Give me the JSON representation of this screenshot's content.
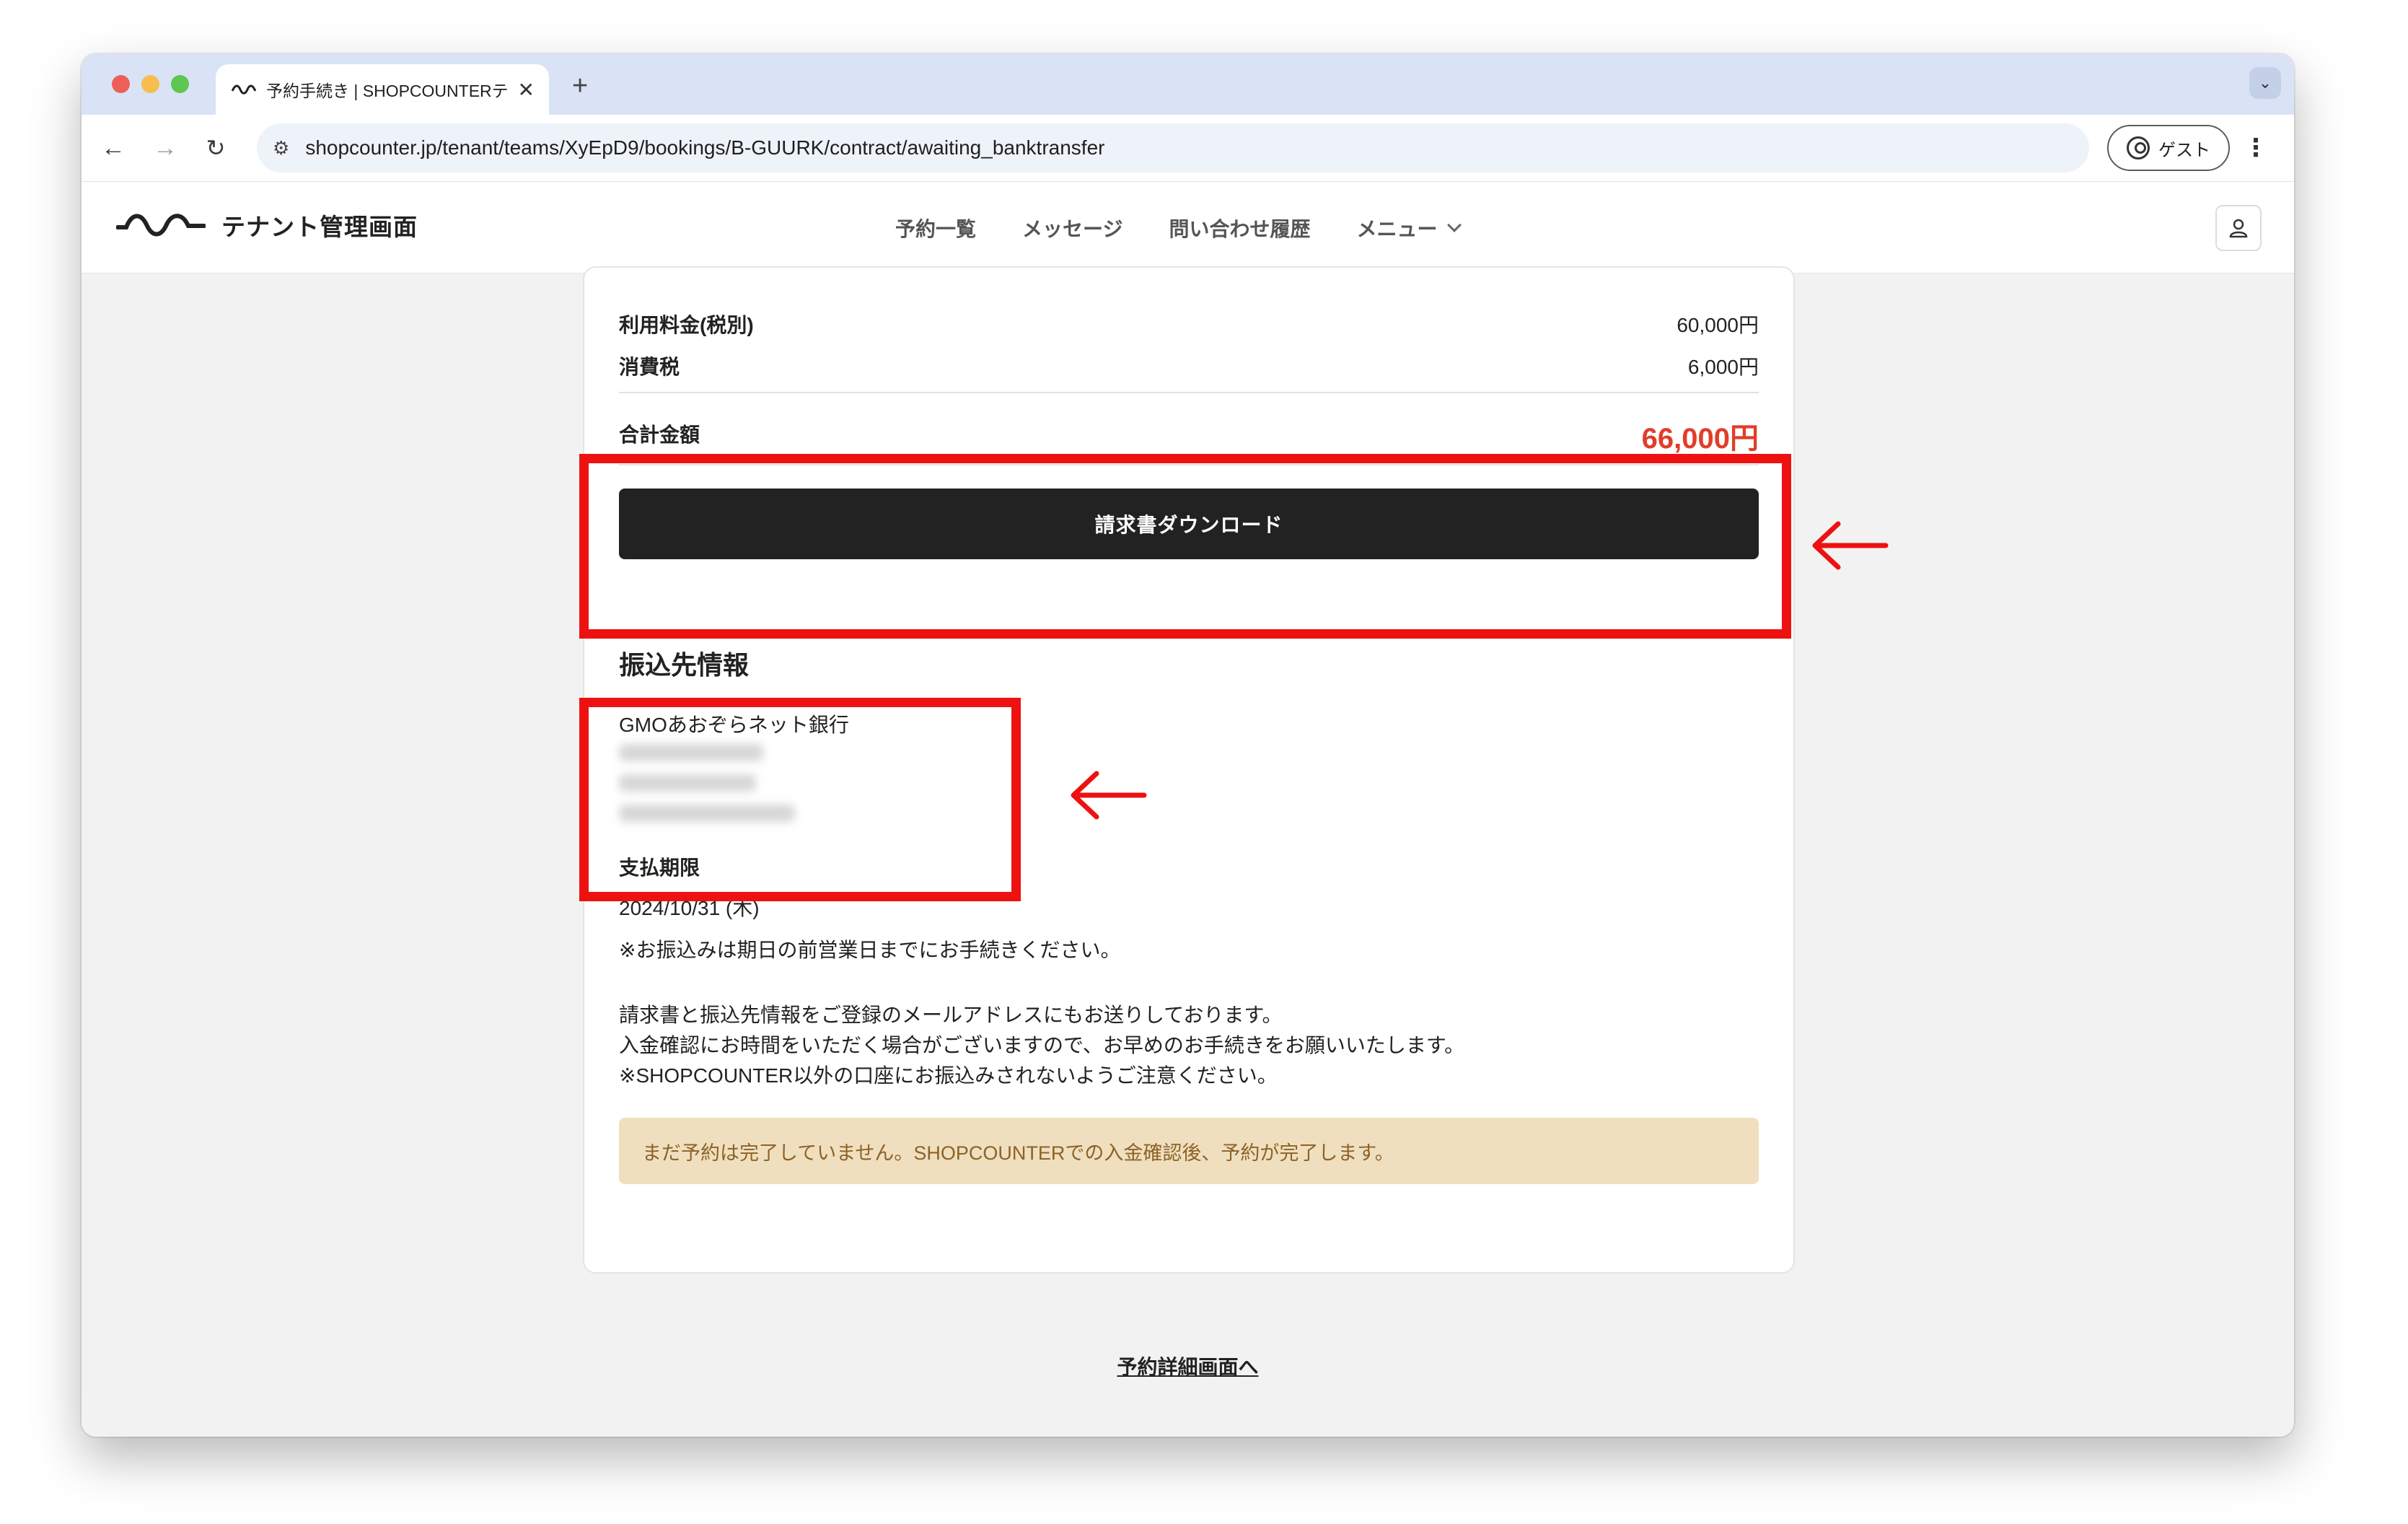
{
  "browser": {
    "tab_title": "予約手続き | SHOPCOUNTERテ",
    "tab_close": "✕",
    "new_tab": "+",
    "tab_menu": "⌄",
    "nav_back": "←",
    "nav_forward": "→",
    "nav_reload": "↻",
    "site_info": "⚙",
    "url": "shopcounter.jp/tenant/teams/XyEpD9/bookings/B-GUURK/contract/awaiting_banktransfer",
    "profile_label": "ゲスト",
    "more": "⋮"
  },
  "app": {
    "brand": "テナント管理画面",
    "nav": {
      "bookings": "予約一覧",
      "messages": "メッセージ",
      "inquiries": "問い合わせ履歴",
      "menu": "メニュー"
    }
  },
  "invoice": {
    "fee_label": "利用料金(税別)",
    "fee_value": "60,000円",
    "tax_label": "消費税",
    "tax_value": "6,000円",
    "total_label": "合計金額",
    "total_value": "66,000円",
    "download_button": "請求書ダウンロード"
  },
  "transfer": {
    "section_title": "振込先情報",
    "bank_name": "GMOあおぞらネット銀行",
    "due_label": "支払期限",
    "due_date": "2024/10/31 (木)",
    "due_note": "※お振込みは期日の前営業日までにお手続きください。",
    "info_line1": "請求書と振込先情報をご登録のメールアドレスにもお送りしております。",
    "info_line2": "入金確認にお時間をいただく場合がございますので、お早めのお手続きをお願いいたします。",
    "info_line3": "※SHOPCOUNTER以外の口座にお振込みされないようご注意ください。",
    "notice": "まだ予約は完了していません。SHOPCOUNTERでの入金確認後、予約が完了します。"
  },
  "footer_link": "予約詳細画面へ",
  "colors": {
    "total": "#e23d2a",
    "button": "#222222",
    "notice_bg": "#efdfbe",
    "notice_text": "#8d6228",
    "annotation": "#ee1111"
  }
}
